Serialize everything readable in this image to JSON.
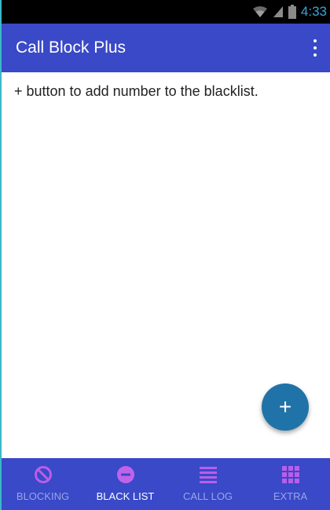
{
  "status_bar": {
    "time": "4:33"
  },
  "app_bar": {
    "title": "Call Block Plus"
  },
  "main": {
    "hint_text": "+ button to add number to the blacklist."
  },
  "fab": {
    "label": "+"
  },
  "bottom_nav": {
    "items": [
      {
        "label": "BLOCKING",
        "icon": "block-icon"
      },
      {
        "label": "BLACK LIST",
        "icon": "minus-circle-icon",
        "active": true
      },
      {
        "label": "CALL LOG",
        "icon": "list-icon"
      },
      {
        "label": "EXTRA",
        "icon": "grid-icon"
      }
    ]
  },
  "colors": {
    "primary": "#3949c7",
    "fab": "#1f73a8",
    "icon_purple": "#b95ee8",
    "status_accent": "#37a6dc"
  }
}
